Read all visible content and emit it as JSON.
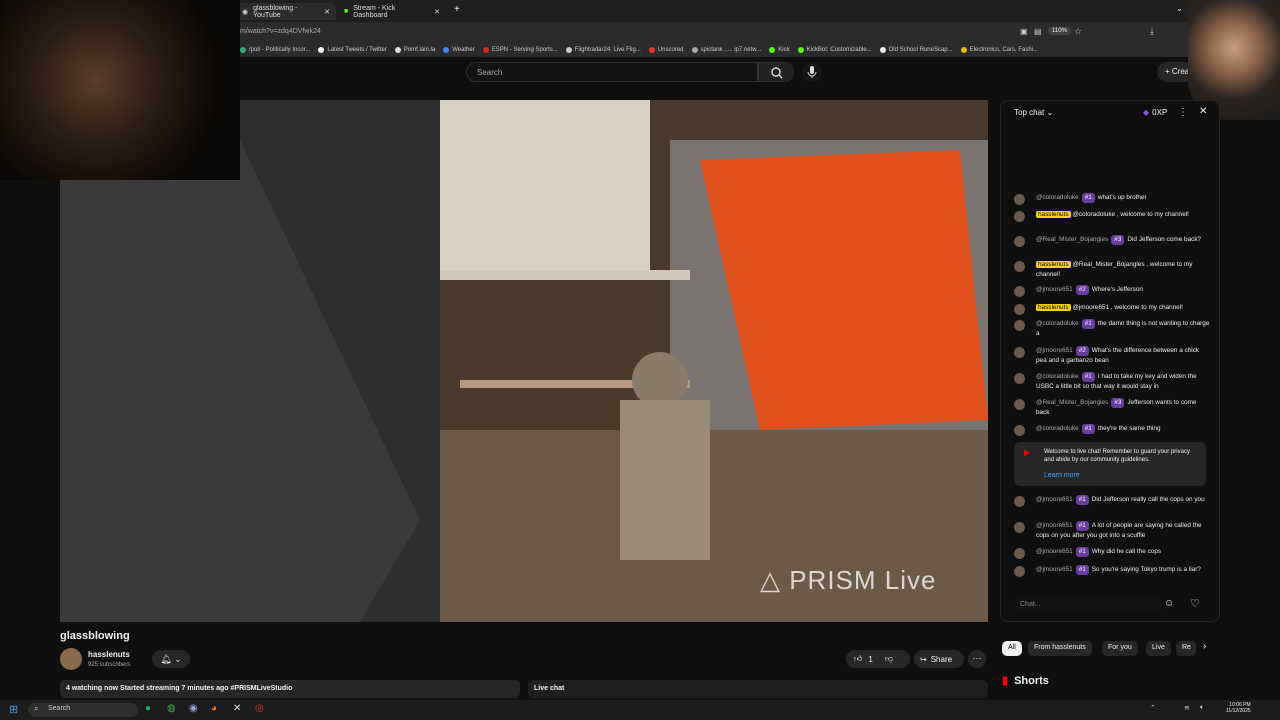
{
  "browser": {
    "tabs": [
      {
        "label": "glassblowing - YouTube",
        "active": true
      },
      {
        "label": "Stream - Kick Dashboard",
        "active": false
      }
    ],
    "url": "m/watch?v=zdq4DVfwk24",
    "zoom": "110%",
    "bookmarks": [
      "/pol/ - Politically Incor...",
      "Latest Tweets / Twitter",
      "Pomf.lain.la",
      "Weather",
      "ESPN - Serving Sports...",
      "Flightradar24: Live Flig...",
      "Unscored",
      "spictank ..... ip7.netw...",
      "Kick",
      "KickBot: Customizable...",
      "Old School RuneScap...",
      "Electronics, Cars, Fashi..."
    ]
  },
  "header": {
    "search_placeholder": "Search",
    "create_label": "Crea"
  },
  "video": {
    "watermark": "PRISM Live",
    "title": "glassblowing",
    "channel": "hasslenuts",
    "subscribers": "925 subscribers",
    "likes": "1",
    "share_label": "Share",
    "watching": "4 watching now  Started streaming 7 minutes ago  #PRISMLiveStudio",
    "live_chat_label": "Live chat"
  },
  "chat": {
    "mode": "Top chat",
    "xp": "0XP",
    "messages": [
      {
        "author": "@coloradoluke",
        "badge": "#1",
        "text": "what's up brother",
        "owner": false
      },
      {
        "author": "hasslenuts",
        "badge": "",
        "text": "@coloradoluke , welcome to my channel!",
        "owner": true
      },
      {
        "author": "@Real_Mister_Bojangles",
        "badge": "#3",
        "text": "Did Jefferson come back?",
        "owner": false
      },
      {
        "author": "hasslenuts",
        "badge": "",
        "text": "@Real_Mister_Bojangles , welcome to my channel!",
        "owner": true
      },
      {
        "author": "@jmoore651",
        "badge": "#2",
        "text": "Where's Jefferson",
        "owner": false
      },
      {
        "author": "hasslenuts",
        "badge": "",
        "text": "@jmoore651 , welcome to my channel!",
        "owner": true
      },
      {
        "author": "@coloradoluke",
        "badge": "#1",
        "text": "the damn thing is not wanting to charge a",
        "owner": false
      },
      {
        "author": "@jmoore651",
        "badge": "#2",
        "text": "What's the difference between a chick pea and a garbanzo bean",
        "owner": false
      },
      {
        "author": "@coloradoluke",
        "badge": "#1",
        "text": "I had to take my key and widen the USBC a little bit so that way it would stay in",
        "owner": false
      },
      {
        "author": "@Real_Mister_Bojangles",
        "badge": "#3",
        "text": "Jefferson wants to come back",
        "owner": false
      },
      {
        "author": "@coloradoluke",
        "badge": "#1",
        "text": "they're the same thing",
        "owner": false
      },
      {
        "author": "@jmoore651",
        "badge": "#1",
        "text": "Did Jefferson really call the cops on you",
        "owner": false
      },
      {
        "author": "@jmoore651",
        "badge": "#1",
        "text": "A lot of people are saying he called the cops on you after you got into a scuffle",
        "owner": false
      },
      {
        "author": "@jmoore651",
        "badge": "#1",
        "text": "Why did he call the cops",
        "owner": false
      },
      {
        "author": "@jmoore651",
        "badge": "#1",
        "text": "So you're saying Tokyo trump is a liar?",
        "owner": false
      }
    ],
    "notice": "Welcome to live chat! Remember to guard your privacy and abide by our community guidelines.",
    "learn_more": "Learn more",
    "input_placeholder": "Chat..."
  },
  "chips": [
    "All",
    "From hasslenuts",
    "For you",
    "Live",
    "Re"
  ],
  "shorts_label": "Shorts",
  "taskbar": {
    "search": "Search",
    "time": "10:06 PM",
    "date": "11/12/2025"
  },
  "colors": {
    "accent": "#f9d500",
    "badge": "#6a3ea1",
    "link": "#3ea6ff"
  }
}
